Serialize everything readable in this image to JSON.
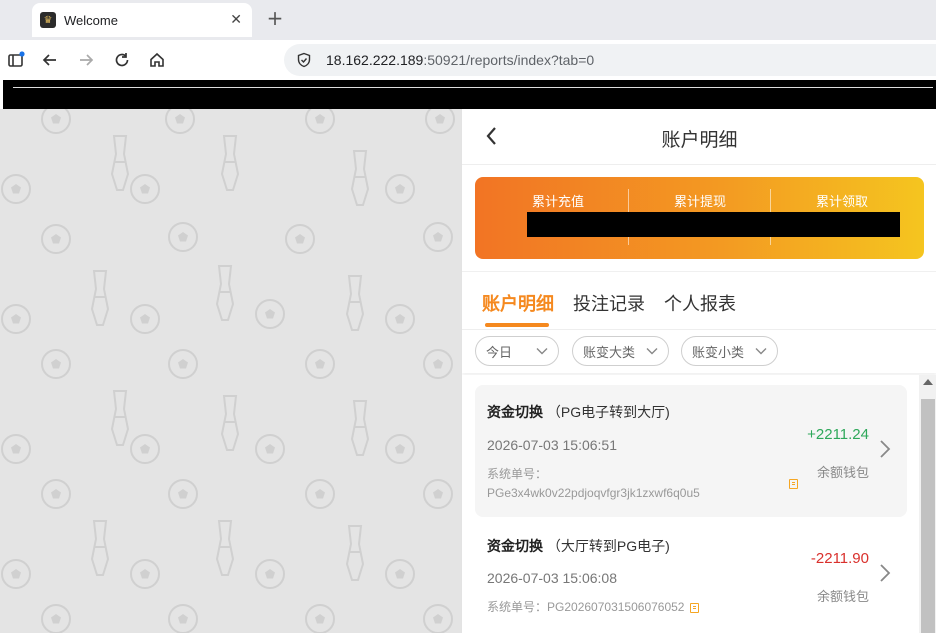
{
  "browser": {
    "tab_title": "Welcome",
    "tab_close": "✕",
    "new_tab": "+",
    "url_host": "18.162.222.189",
    "url_rest": ":50921/reports/index?tab=0"
  },
  "header": {
    "title": "账户明细"
  },
  "summary": {
    "items": [
      {
        "label": "累计充值"
      },
      {
        "label": "累计提现"
      },
      {
        "label": "累计领取"
      }
    ]
  },
  "tabs": [
    {
      "label": "账户明细",
      "active": true
    },
    {
      "label": "投注记录",
      "active": false
    },
    {
      "label": "个人报表",
      "active": false
    }
  ],
  "filters": [
    {
      "value": "今日"
    },
    {
      "value": "账变大类"
    },
    {
      "value": "账变小类"
    }
  ],
  "records": [
    {
      "type": "资金切换",
      "desc": "（PG电子转到大厅)",
      "time": "2026-07-03 15:06:51",
      "order_label": "系统单号：",
      "order_no": "PGe3x4wk0v22pdjoqvfgr3jk1zxwf6q0u5",
      "amount": "+2211.24",
      "wallet": "余额钱包"
    },
    {
      "type": "资金切换",
      "desc": "（大厅转到PG电子)",
      "time": "2026-07-03 15:06:08",
      "order_label": "系统单号：",
      "order_no": "PG202607031506076052",
      "amount": "-2211.90",
      "wallet": "余额钱包"
    }
  ],
  "colors": {
    "accent": "#f5891f",
    "positive": "#2ea85a",
    "negative": "#d9302c"
  }
}
